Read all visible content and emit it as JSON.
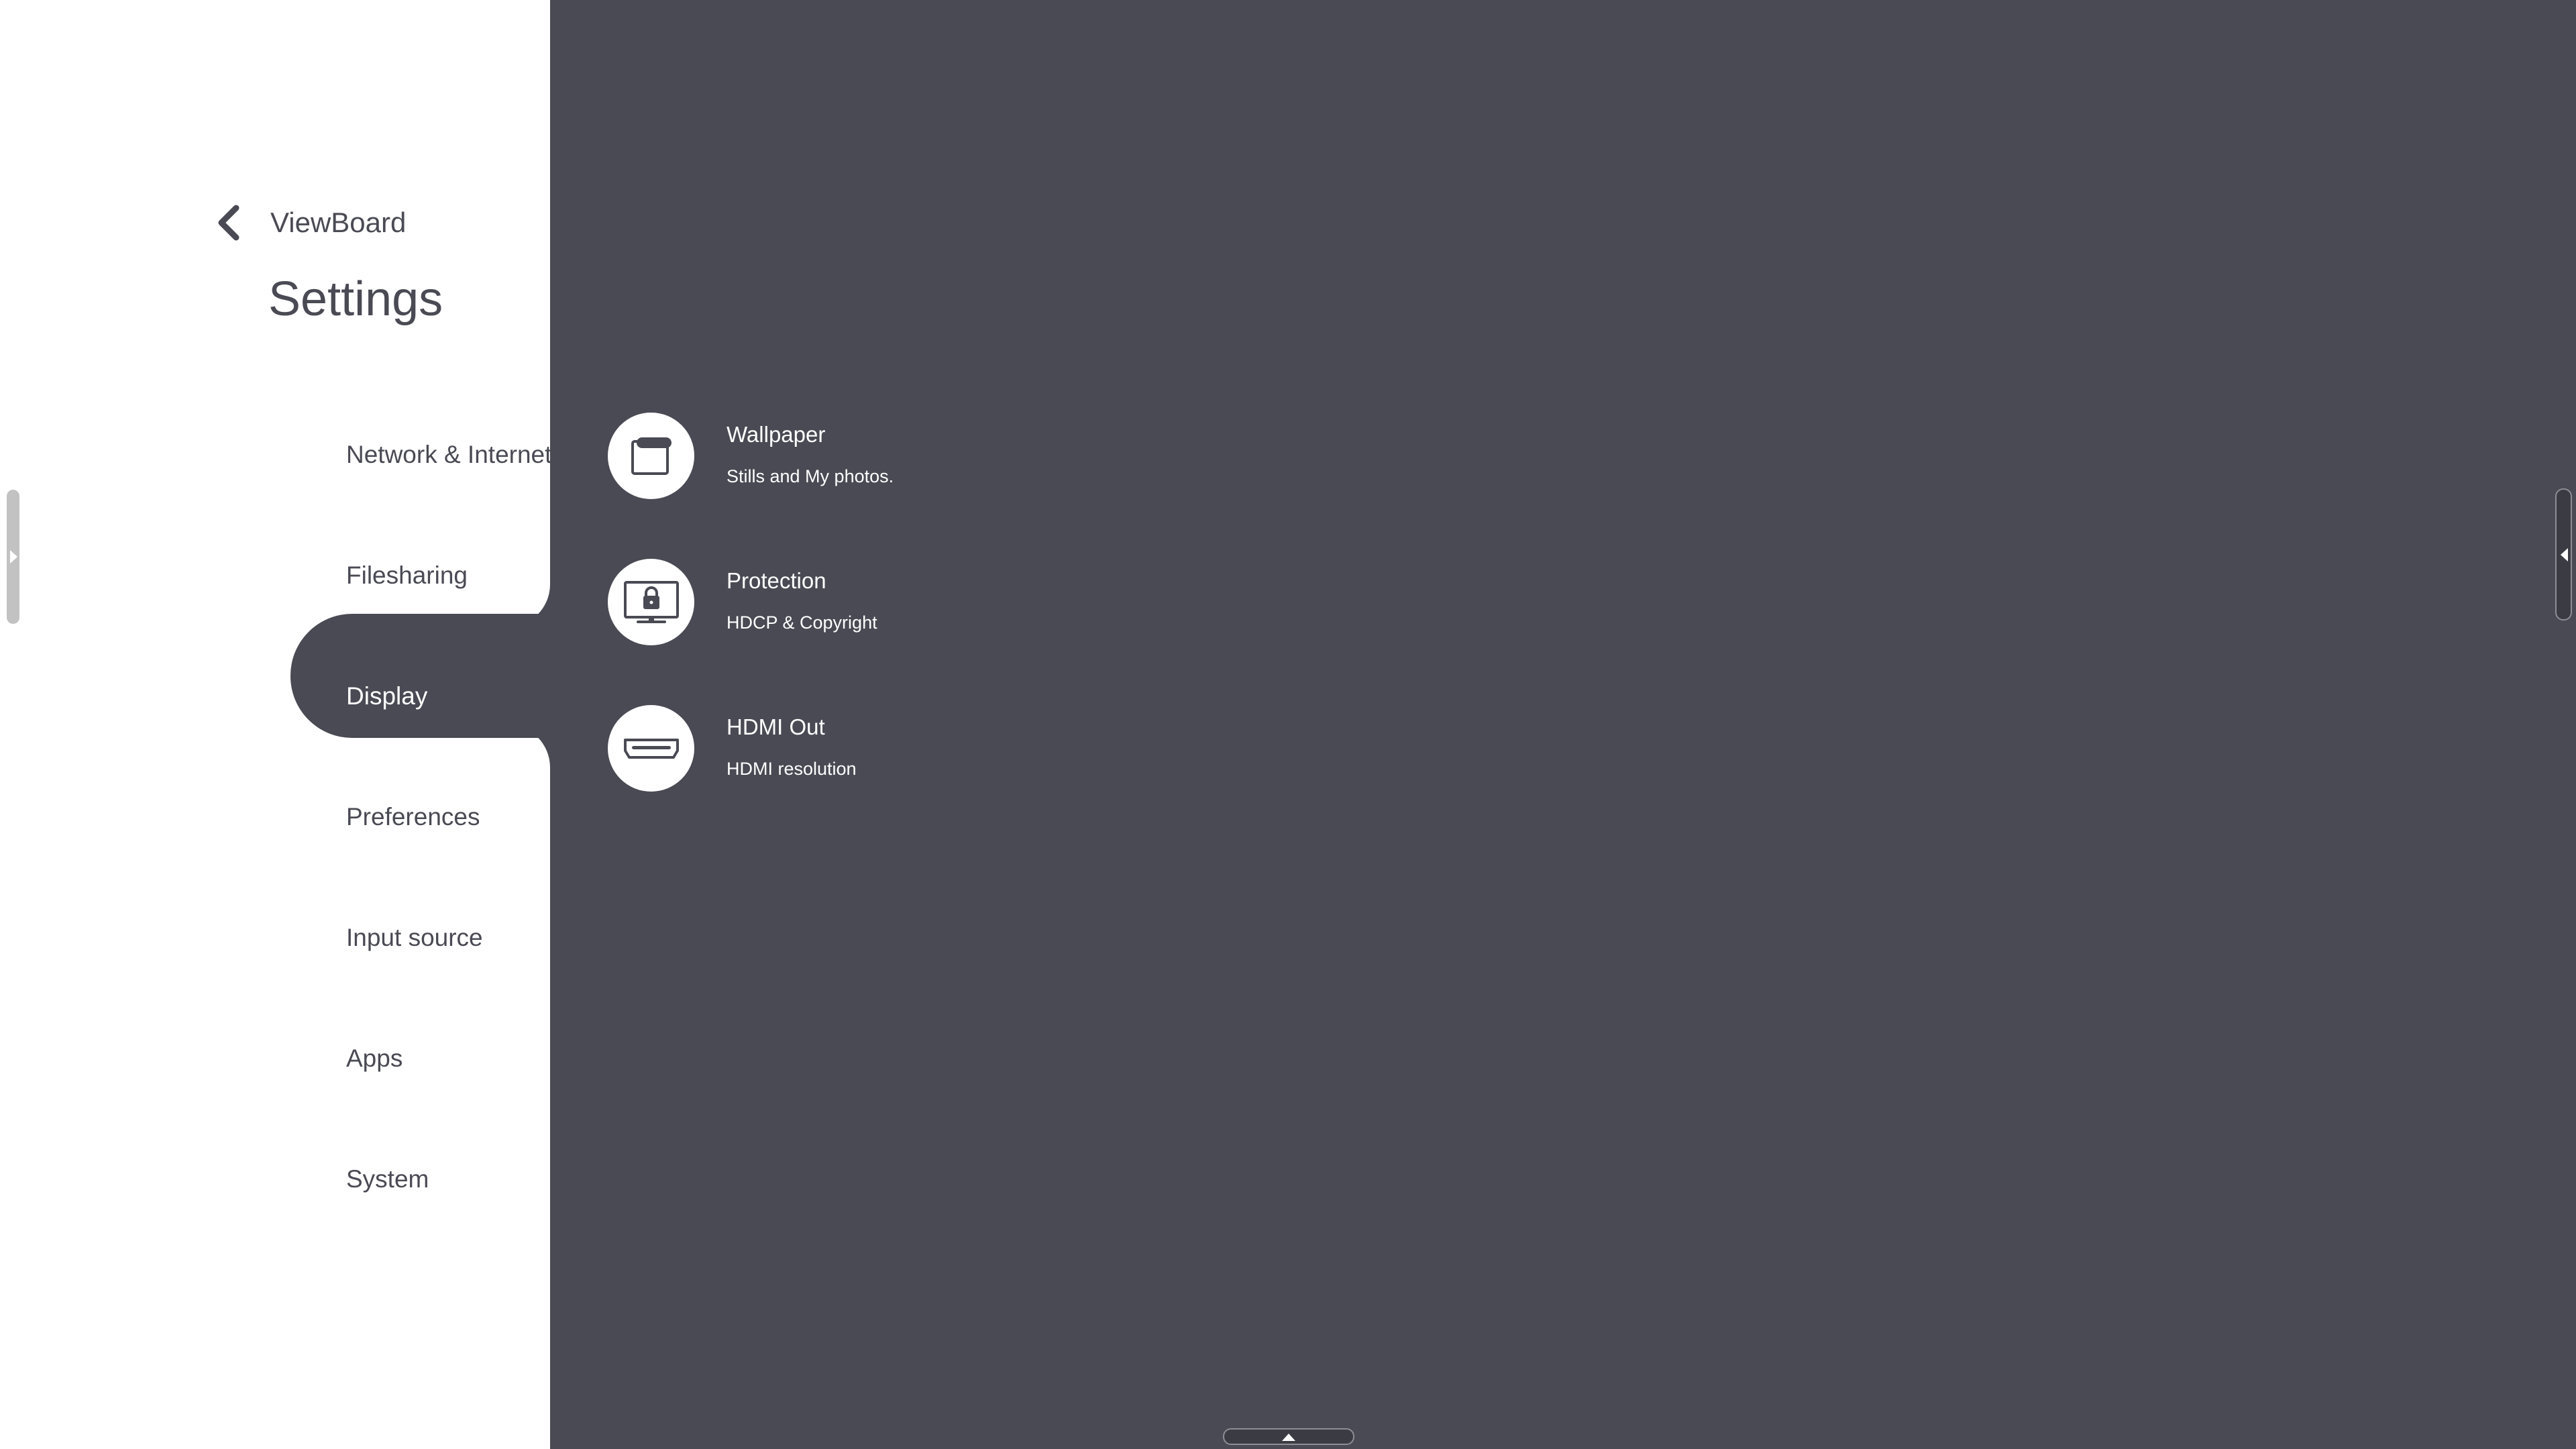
{
  "header": {
    "breadcrumb": "ViewBoard",
    "title": "Settings"
  },
  "sidebar": {
    "active_index": 2,
    "items": [
      {
        "label": "Network & Internet"
      },
      {
        "label": "Filesharing"
      },
      {
        "label": "Display"
      },
      {
        "label": "Preferences"
      },
      {
        "label": "Input source"
      },
      {
        "label": "Apps"
      },
      {
        "label": "System"
      }
    ]
  },
  "content": {
    "items": [
      {
        "title": "Wallpaper",
        "subtitle": "Stills and My photos.",
        "icon": "wallpaper-icon"
      },
      {
        "title": "Protection",
        "subtitle": "HDCP & Copyright",
        "icon": "monitor-lock-icon"
      },
      {
        "title": "HDMI Out",
        "subtitle": "HDMI resolution",
        "icon": "hdmi-port-icon"
      }
    ]
  },
  "colors": {
    "background": "#4a4a54",
    "sidebar": "#ffffff",
    "text_dark": "#4a4a54",
    "text_light": "#ffffff"
  }
}
